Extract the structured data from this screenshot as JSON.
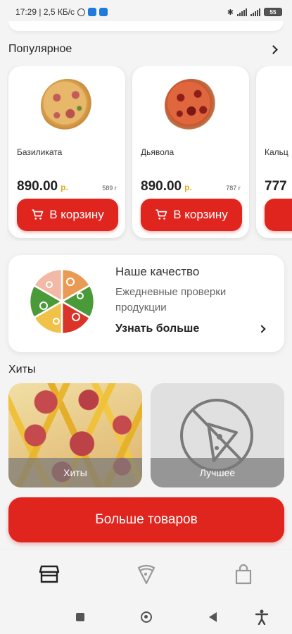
{
  "status_bar": {
    "time_speed": "17:29 | 2,5 КБ/с",
    "battery": "55"
  },
  "popular": {
    "title": "Популярное"
  },
  "products": [
    {
      "name": "Базиликата",
      "price": "890.00",
      "currency": "р.",
      "weight": "589 г",
      "cart_label": "В корзину"
    },
    {
      "name": "Дьявола",
      "price": "890.00",
      "currency": "р.",
      "weight": "787 г",
      "cart_label": "В корзину"
    },
    {
      "name": "Кальц",
      "price": "777",
      "currency": "",
      "weight": "",
      "cart_label": ""
    }
  ],
  "quality": {
    "title": "Наше качество",
    "description": "Ежедневные проверки продукции",
    "more_label": "Узнать больше"
  },
  "hits_section": {
    "title": "Хиты",
    "tiles": [
      {
        "label": "Хиты"
      },
      {
        "label": "Лучшее"
      }
    ]
  },
  "more_button": {
    "label": "Больше товаров"
  },
  "bottom_nav": {
    "items": [
      "store-icon",
      "pizza-slice-icon",
      "bag-icon"
    ],
    "active_index": 0
  },
  "colors": {
    "accent_red": "#e0251f",
    "currency_gold": "#e2a81e",
    "background": "#f4f4f4"
  }
}
